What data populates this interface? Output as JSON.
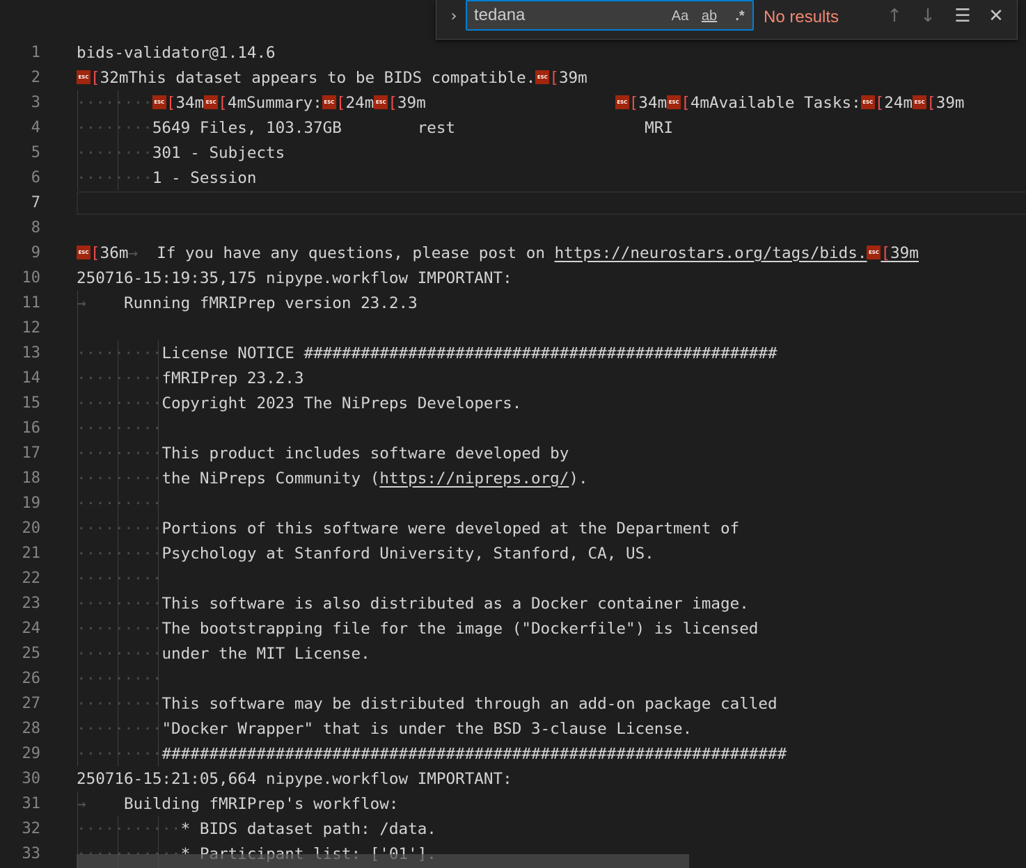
{
  "find": {
    "query": "tedana",
    "result_text": "No results",
    "toggle_icon": "chevron-right-icon",
    "match_case_label": "Aa",
    "whole_word_label": "ab",
    "regex_label": ".*",
    "prev_icon": "arrow-up-icon",
    "next_icon": "arrow-down-icon",
    "selection_icon": "find-in-selection-icon",
    "close_icon": "close-icon"
  },
  "colors": {
    "background": "#1e1e1e",
    "text": "#d4d4d4",
    "line_number": "#858585",
    "esc_badge": "#a1260d",
    "no_results": "#f48771",
    "find_border": "#007fd4"
  },
  "lines": [
    {
      "n": "1",
      "segs": [
        {
          "t": "bids-validator@1.14.6"
        }
      ]
    },
    {
      "n": "2",
      "segs": [
        {
          "esc": true
        },
        {
          "t": "[",
          "cls": "escb"
        },
        {
          "t": "32mThis dataset appears to be BIDS compatible."
        },
        {
          "esc": true
        },
        {
          "t": "[",
          "cls": "escb"
        },
        {
          "t": "39m"
        }
      ]
    },
    {
      "n": "3",
      "segs": [
        {
          "t": "\t",
          "tab": true
        },
        {
          "esc": true
        },
        {
          "t": "[",
          "cls": "escb"
        },
        {
          "t": "34m"
        },
        {
          "esc": true
        },
        {
          "t": "[",
          "cls": "escb"
        },
        {
          "t": "4mSummary:"
        },
        {
          "esc": true
        },
        {
          "t": "[",
          "cls": "escb"
        },
        {
          "t": "24m"
        },
        {
          "esc": true
        },
        {
          "t": "[",
          "cls": "escb"
        },
        {
          "t": "39m                    "
        },
        {
          "esc": true
        },
        {
          "t": "[",
          "cls": "escb"
        },
        {
          "t": "34m"
        },
        {
          "esc": true
        },
        {
          "t": "[",
          "cls": "escb"
        },
        {
          "t": "4mAvailable Tasks:"
        },
        {
          "esc": true
        },
        {
          "t": "[",
          "cls": "escb"
        },
        {
          "t": "24m"
        },
        {
          "esc": true
        },
        {
          "t": "[",
          "cls": "escb"
        },
        {
          "t": "39m"
        }
      ]
    },
    {
      "n": "4",
      "segs": [
        {
          "t": "\t",
          "tab": true
        },
        {
          "t": "5649 Files, 103.37GB        rest                    MRI"
        }
      ]
    },
    {
      "n": "5",
      "segs": [
        {
          "t": "\t",
          "tab": true
        },
        {
          "t": "301 - Subjects"
        }
      ]
    },
    {
      "n": "6",
      "segs": [
        {
          "t": "\t",
          "tab": true
        },
        {
          "t": "1 - Session"
        }
      ]
    },
    {
      "n": "7",
      "segs": [],
      "current": true
    },
    {
      "n": "8",
      "segs": []
    },
    {
      "n": "9",
      "segs": [
        {
          "esc": true
        },
        {
          "t": "[",
          "cls": "escb"
        },
        {
          "t": "36m"
        },
        {
          "t": "→ ",
          "cls": "tabarrow"
        },
        {
          "t": " If you have any questions, please post on "
        },
        {
          "t": "https://neurostars.org/tags/bids.",
          "cls": "link"
        },
        {
          "esc": true
        },
        {
          "t": "[",
          "cls": "escb link"
        },
        {
          "t": "39m",
          "cls": "link"
        }
      ]
    },
    {
      "n": "10",
      "segs": [
        {
          "t": "250716-15:19:35,175 nipype.workflow IMPORTANT:"
        }
      ]
    },
    {
      "n": "11",
      "segs": [
        {
          "t": "→    ",
          "cls": "tabarrow"
        },
        {
          "t": "Running fMRIPrep version 23.2.3"
        }
      ]
    },
    {
      "n": "12",
      "segs": []
    },
    {
      "n": "13",
      "segs": [
        {
          "t": "         ",
          "pad": true
        },
        {
          "t": "License NOTICE ##################################################"
        }
      ]
    },
    {
      "n": "14",
      "segs": [
        {
          "t": "         ",
          "pad": true
        },
        {
          "t": "fMRIPrep 23.2.3"
        }
      ]
    },
    {
      "n": "15",
      "segs": [
        {
          "t": "         ",
          "pad": true
        },
        {
          "t": "Copyright 2023 The NiPreps Developers."
        }
      ]
    },
    {
      "n": "16",
      "segs": [
        {
          "t": "         ",
          "pad": true
        }
      ]
    },
    {
      "n": "17",
      "segs": [
        {
          "t": "         ",
          "pad": true
        },
        {
          "t": "This product includes software developed by"
        }
      ]
    },
    {
      "n": "18",
      "segs": [
        {
          "t": "         ",
          "pad": true
        },
        {
          "t": "the NiPreps Community ("
        },
        {
          "t": "https://nipreps.org/",
          "cls": "link"
        },
        {
          "t": ")."
        }
      ]
    },
    {
      "n": "19",
      "segs": [
        {
          "t": "         ",
          "pad": true
        }
      ]
    },
    {
      "n": "20",
      "segs": [
        {
          "t": "         ",
          "pad": true
        },
        {
          "t": "Portions of this software were developed at the Department of"
        }
      ]
    },
    {
      "n": "21",
      "segs": [
        {
          "t": "         ",
          "pad": true
        },
        {
          "t": "Psychology at Stanford University, Stanford, CA, US."
        }
      ]
    },
    {
      "n": "22",
      "segs": [
        {
          "t": "         ",
          "pad": true
        }
      ]
    },
    {
      "n": "23",
      "segs": [
        {
          "t": "         ",
          "pad": true
        },
        {
          "t": "This software is also distributed as a Docker container image."
        }
      ]
    },
    {
      "n": "24",
      "segs": [
        {
          "t": "         ",
          "pad": true
        },
        {
          "t": "The bootstrapping file for the image (\"Dockerfile\") is licensed"
        }
      ]
    },
    {
      "n": "25",
      "segs": [
        {
          "t": "         ",
          "pad": true
        },
        {
          "t": "under the MIT License."
        }
      ]
    },
    {
      "n": "26",
      "segs": [
        {
          "t": "         ",
          "pad": true
        }
      ]
    },
    {
      "n": "27",
      "segs": [
        {
          "t": "         ",
          "pad": true
        },
        {
          "t": "This software may be distributed through an add-on package called"
        }
      ]
    },
    {
      "n": "28",
      "segs": [
        {
          "t": "         ",
          "pad": true
        },
        {
          "t": "\"Docker Wrapper\" that is under the BSD 3-clause License."
        }
      ]
    },
    {
      "n": "29",
      "segs": [
        {
          "t": "         ",
          "pad": true
        },
        {
          "t": "##################################################################"
        }
      ]
    },
    {
      "n": "30",
      "segs": [
        {
          "t": "250716-15:21:05,664 nipype.workflow IMPORTANT:"
        }
      ]
    },
    {
      "n": "31",
      "segs": [
        {
          "t": "→    ",
          "cls": "tabarrow"
        },
        {
          "t": "Building fMRIPrep's workflow:"
        }
      ]
    },
    {
      "n": "32",
      "segs": [
        {
          "t": "           ",
          "pad": true
        },
        {
          "t": "* BIDS dataset path: /data."
        }
      ]
    },
    {
      "n": "33",
      "segs": [
        {
          "t": "           ",
          "pad": true
        },
        {
          "t": "* Participant list: ['01']."
        }
      ]
    }
  ]
}
